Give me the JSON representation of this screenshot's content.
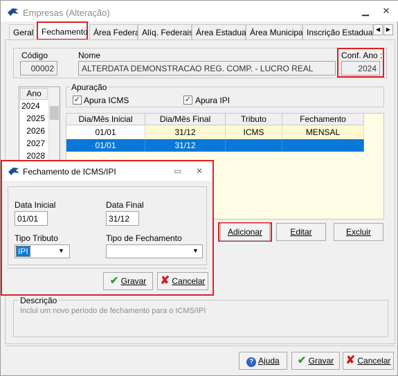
{
  "window": {
    "title": "Empresas (Alteração)",
    "minimize": "▁",
    "close": "✕"
  },
  "tabs": [
    {
      "label": "Geral"
    },
    {
      "label": "Fechamento"
    },
    {
      "label": "Área Federal"
    },
    {
      "label": "Alíq. Federais"
    },
    {
      "label": "Área Estadual"
    },
    {
      "label": "Área Municipal"
    },
    {
      "label": "Inscrição Estadual S"
    }
  ],
  "tab_scroll": {
    "left": "◀",
    "right": "▶"
  },
  "company": {
    "codigo_label": "Código",
    "codigo_value": "00002",
    "nome_label": "Nome",
    "nome_value": "ALTERDATA DEMONSTRACAO REG. COMP. - LUCRO REAL",
    "conf_ano_label": "Conf. Ano :",
    "conf_ano_value": "2024"
  },
  "years": {
    "header": "Ano",
    "items": [
      "2024",
      "2025",
      "2026",
      "2027",
      "2028"
    ]
  },
  "apuracao": {
    "title": "Apuração",
    "icms_label": "Apura ICMS",
    "ipi_label": "Apura IPI",
    "check_mark": "✓"
  },
  "grid": {
    "headers": [
      "Dia/Mês Inicial",
      "Dia/Mês Final",
      "Tributo",
      "Fechamento"
    ],
    "rows": [
      [
        "01/01",
        "31/12",
        "ICMS",
        "MENSAL"
      ],
      [
        "01/01",
        "31/12",
        "",
        ""
      ]
    ]
  },
  "grid_buttons": {
    "add": "Adicionar",
    "edit": "Editar",
    "delete": "Excluir"
  },
  "dialog": {
    "title": "Fechamento de ICMS/IPI",
    "minimize": "▭",
    "close": "✕",
    "data_inicial_label": "Data Inicial",
    "data_inicial_value": "01/01",
    "data_final_label": "Data Final",
    "data_final_value": "31/12",
    "tipo_tributo_label": "Tipo Tributo",
    "tipo_tributo_value": "IPI",
    "tipo_fechamento_label": "Tipo de Fechamento",
    "tipo_fechamento_value": "",
    "gravar": "Gravar",
    "cancelar": "Cancelar"
  },
  "descricao": {
    "title": "Descrição",
    "text": "Inclui um novo período de fechamento para o ICMS/IPI"
  },
  "footer": {
    "ajuda": "Ajuda",
    "gravar": "Gravar",
    "cancelar": "Cancelar"
  },
  "icons": {
    "check": "✔",
    "x": "✘",
    "help": "?",
    "dropdown": "▼"
  },
  "colors": {
    "accent_red": "#e02020",
    "selected_row": "#0a78d7",
    "grid_bg": "#fffde6",
    "row_yellow": "#fff8d0"
  }
}
